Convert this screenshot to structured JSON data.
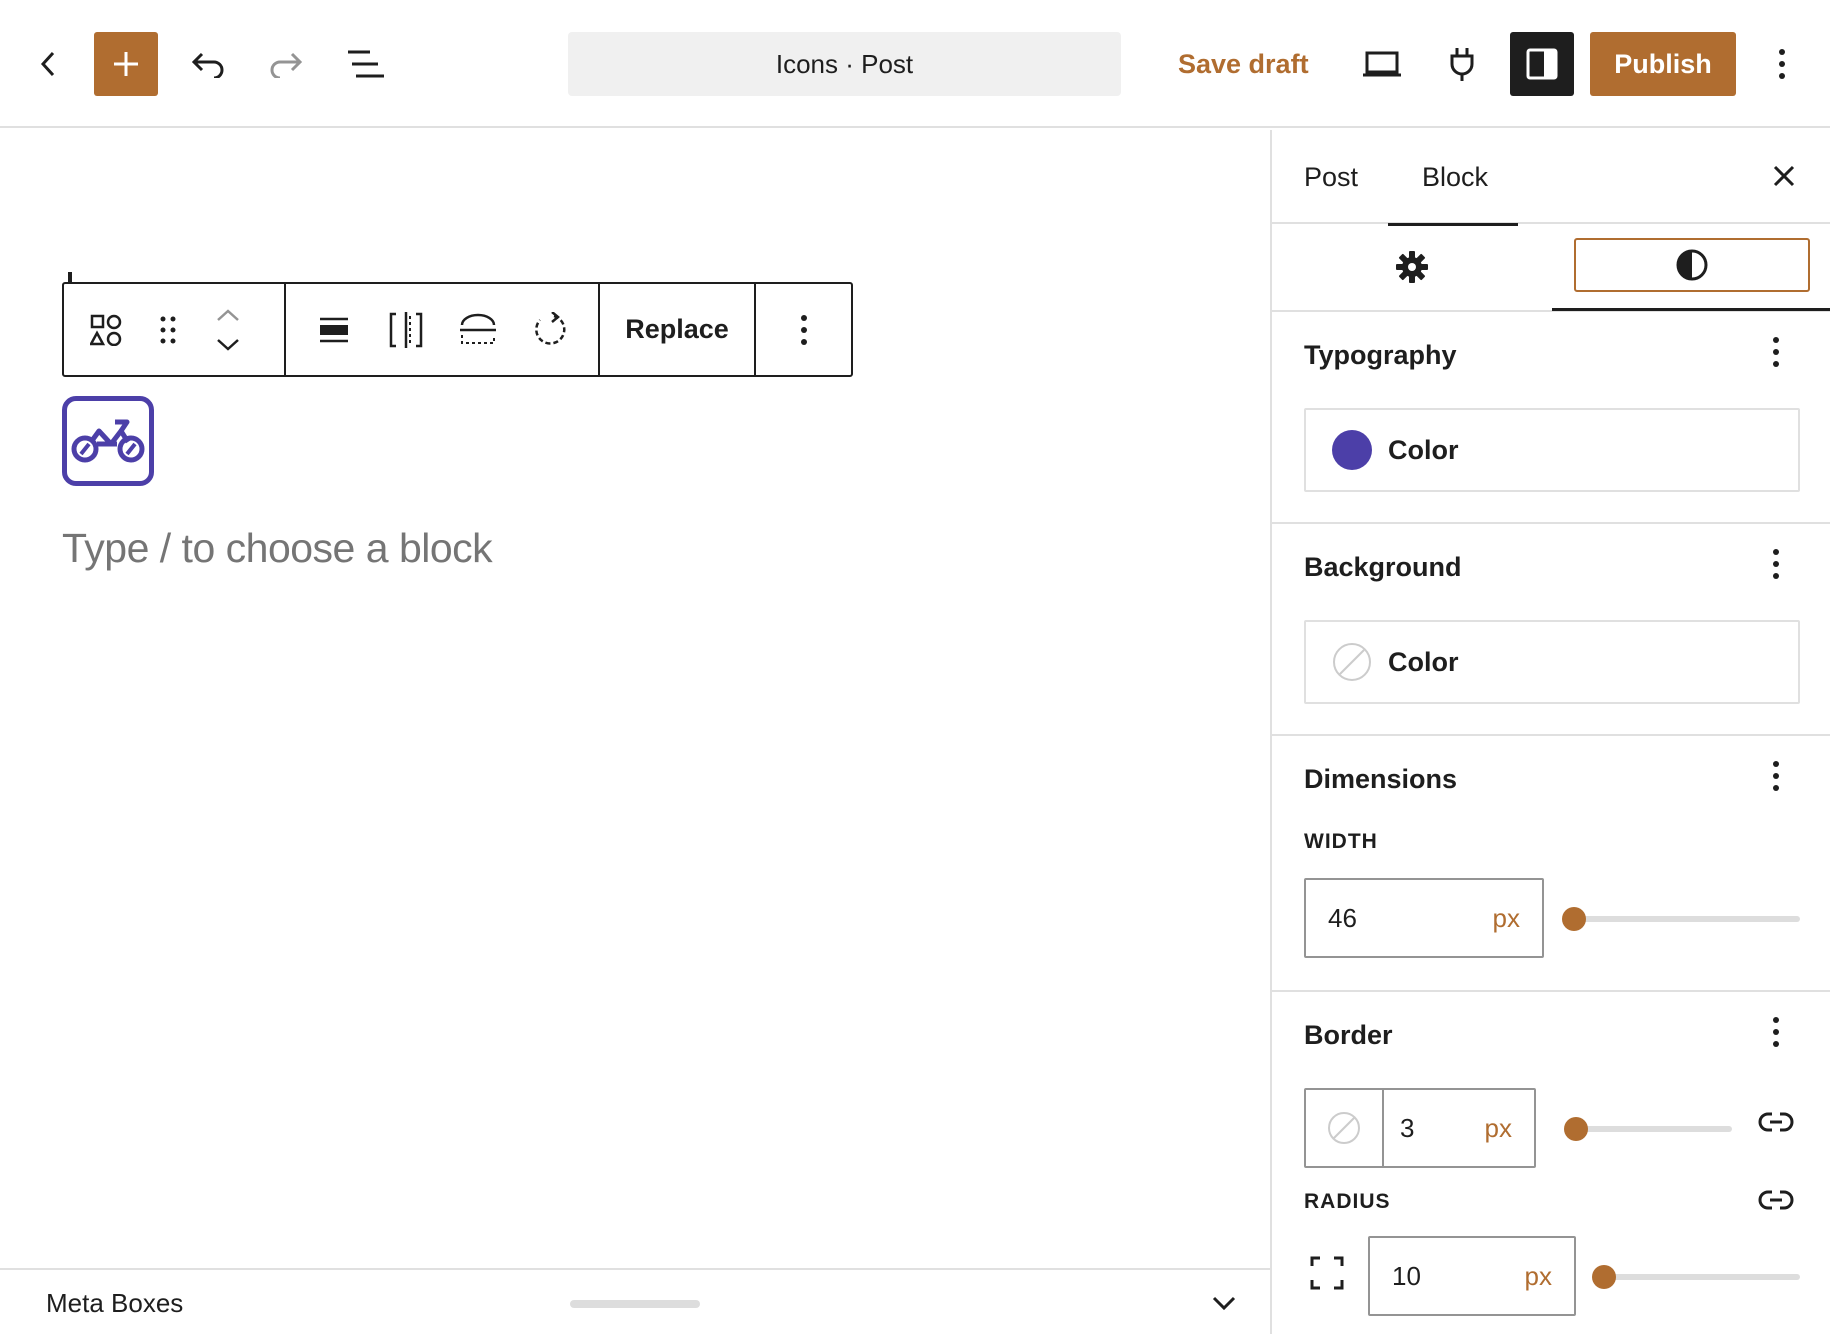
{
  "header": {
    "back_icon": "chevron-left-icon",
    "add_icon": "plus-icon",
    "undo_icon": "undo-icon",
    "redo_icon": "redo-icon",
    "list_view_icon": "list-view-icon",
    "document_title": "Icons · Post",
    "save_draft_label": "Save draft",
    "view_icon": "laptop-icon",
    "plugin_icon": "plug-icon",
    "settings_icon": "sidebar-icon",
    "publish_label": "Publish",
    "options_icon": "more-vertical-icon"
  },
  "block_toolbar": {
    "icons": [
      "icon-block-type-icon",
      "drag-handle-icon",
      "move-up-icon",
      "move-down-icon",
      "align-icon",
      "justify-icon",
      "wide-align-icon",
      "rotate-icon"
    ],
    "replace_label": "Replace",
    "more_icon": "more-vertical-icon"
  },
  "editor": {
    "selected_icon": "motorcycle-icon",
    "placeholder": "Type / to choose a block"
  },
  "metabox": {
    "label": "Meta Boxes",
    "toggle_icon": "chevron-down-icon"
  },
  "sidebar": {
    "tabs": [
      {
        "label": "Post",
        "active": false
      },
      {
        "label": "Block",
        "active": true
      }
    ],
    "close_icon": "close-icon",
    "subtabs": [
      {
        "icon": "gear-icon",
        "active": false
      },
      {
        "icon": "styles-icon",
        "active": true
      }
    ],
    "typography": {
      "title": "Typography",
      "color_label": "Color",
      "color_value": "#4c3fa8"
    },
    "background": {
      "title": "Background",
      "color_label": "Color",
      "color_value": "none"
    },
    "dimensions": {
      "title": "Dimensions",
      "width_label": "WIDTH",
      "width_value": "46",
      "width_unit": "px",
      "width_slider_fraction": 0.0
    },
    "border": {
      "title": "Border",
      "width_value": "3",
      "width_unit": "px",
      "width_slider_fraction": 0.0,
      "link_icon": "unlink-icon",
      "radius_label": "RADIUS",
      "radius_value": "10",
      "radius_unit": "px",
      "radius_slider_fraction": 0.0
    }
  },
  "colors": {
    "accent": "#b06d30",
    "icon_color": "#4c3fa8"
  }
}
